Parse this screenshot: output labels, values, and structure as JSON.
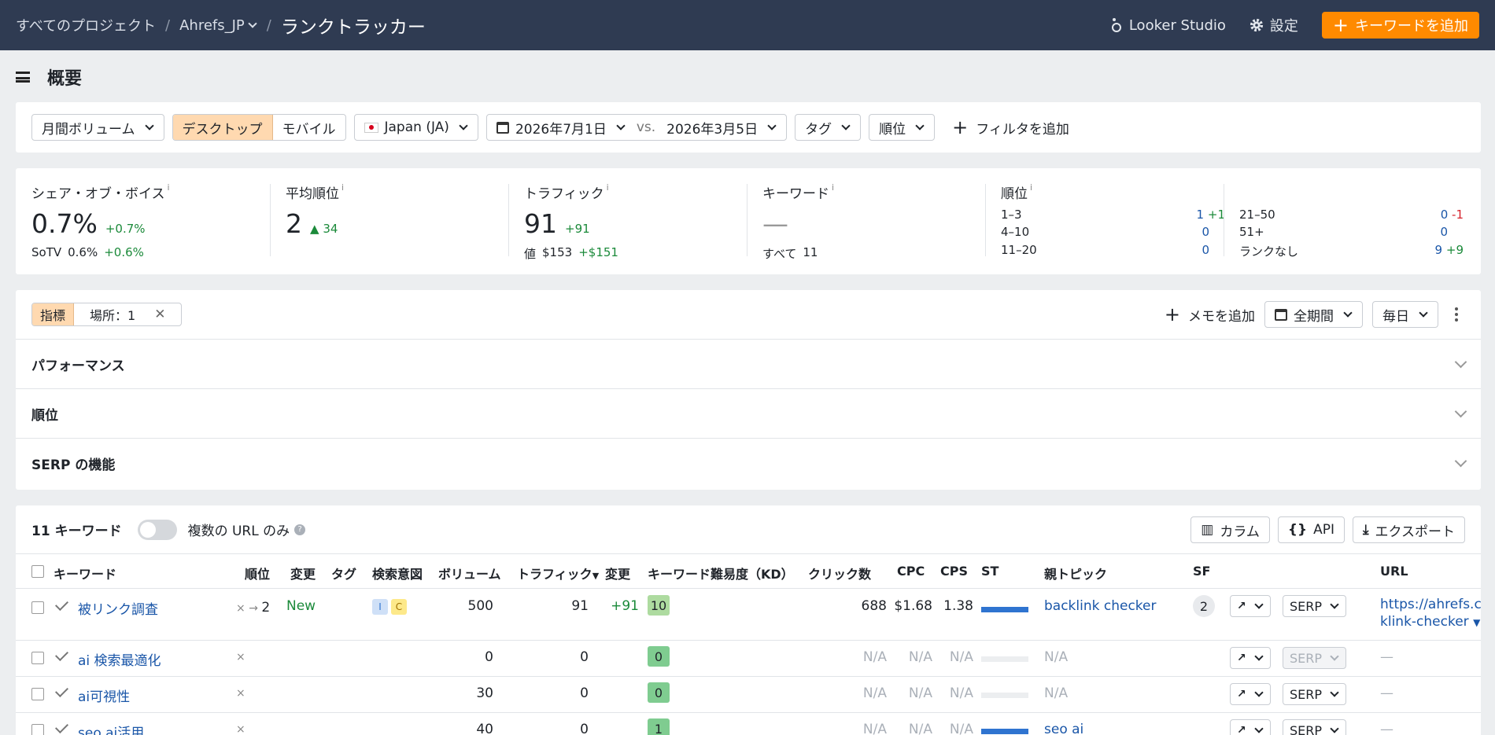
{
  "topbar": {
    "crumb_all": "すべてのプロジェクト",
    "crumb_project": "Ahrefs_JP",
    "crumb_current": "ランクトラッカー",
    "looker": "Looker Studio",
    "settings": "設定",
    "add_keyword": "キーワードを追加"
  },
  "page": {
    "title": "概要"
  },
  "filters": {
    "volume": "月間ボリューム",
    "desktop": "デスクトップ",
    "mobile": "モバイル",
    "country": "Japan (JA)",
    "date_from": "2026年7月1日",
    "vs": "vs.",
    "date_to": "2026年3月5日",
    "tags": "タグ",
    "position": "順位",
    "add_filter": "フィルタを追加"
  },
  "stats": {
    "sov": {
      "label": "シェア・オブ・ボイス",
      "info": "i",
      "value": "0.7%",
      "delta": "+0.7%",
      "sub_label": "SoTV",
      "sub_value": "0.6%",
      "sub_delta": "+0.6%"
    },
    "avg_pos": {
      "label": "平均順位",
      "info": "i",
      "value": "2",
      "delta": "34"
    },
    "traffic": {
      "label": "トラフィック",
      "info": "i",
      "value": "91",
      "delta": "+91",
      "sub_label": "値",
      "sub_value": "$153",
      "sub_delta": "+$151"
    },
    "keywords": {
      "label": "キーワード",
      "info": "i",
      "value": "—",
      "sub_label": "すべて",
      "sub_value": "11"
    },
    "ranks": {
      "label": "順位",
      "info": "i",
      "r1_label": "1–3",
      "r1_value": "1",
      "r1_delta": "+1",
      "r2_label": "4–10",
      "r2_value": "0",
      "r3_label": "11–20",
      "r3_value": "0",
      "r4_label": "21–50",
      "r4_value": "0",
      "r4_delta": "-1",
      "r5_label": "51+",
      "r5_value": "0",
      "r6_label": "ランクなし",
      "r6_value": "9",
      "r6_delta": "+9"
    }
  },
  "section": {
    "metric_chip": "指標",
    "location_chip": "場所：1",
    "add_memo": "メモを追加",
    "period": "全期間",
    "interval": "毎日",
    "panels": [
      "パフォーマンス",
      "順位",
      "SERP の機能"
    ]
  },
  "table": {
    "count_label": "11 キーワード",
    "multi_url": "複数の URL のみ",
    "columns_btn": "カラム",
    "api_btn": "API",
    "export_btn": "エクスポート",
    "headers": {
      "keyword": "キーワード",
      "position": "順位",
      "change": "変更",
      "tag": "タグ",
      "intent": "検索意図",
      "volume": "ボリューム",
      "traffic": "トラフィック",
      "traffic_change": "変更",
      "kd": "キーワード難易度（KD）",
      "clicks": "クリック数",
      "cpc": "CPC",
      "cps": "CPS",
      "st": "ST",
      "parent": "親トピック",
      "sf": "SF",
      "url": "URL"
    },
    "serp_label": "SERP",
    "rows": [
      {
        "keyword": "被リンク調査",
        "pos_prev": "×",
        "arrow": "→",
        "pos": "2",
        "change": "New",
        "intent1": "I",
        "intent2": "C",
        "volume": "500",
        "traffic": "91",
        "traffic_change": "+91",
        "kd": "10",
        "clicks": "688",
        "cpc": "$1.68",
        "cps": "1.38",
        "parent": "backlink checker",
        "sf": "2",
        "url1": "https://ahrefs.com/ba",
        "url2": "klink-checker"
      },
      {
        "keyword": "ai 検索最適化",
        "pos_prev": "×",
        "volume": "0",
        "traffic": "0",
        "kd": "0",
        "clicks": "N/A",
        "cpc": "N/A",
        "cps": "N/A",
        "parent": "N/A",
        "url1": "—"
      },
      {
        "keyword": "ai可視性",
        "pos_prev": "×",
        "volume": "30",
        "traffic": "0",
        "kd": "0",
        "clicks": "N/A",
        "cpc": "N/A",
        "cps": "N/A",
        "parent": "N/A",
        "url1": "—"
      },
      {
        "keyword": "seo ai活用",
        "pos_prev": "×",
        "volume": "40",
        "traffic": "0",
        "kd": "1",
        "clicks": "N/A",
        "cpc": "N/A",
        "cps": "N/A",
        "parent": "seo ai",
        "url1": "—"
      }
    ]
  }
}
